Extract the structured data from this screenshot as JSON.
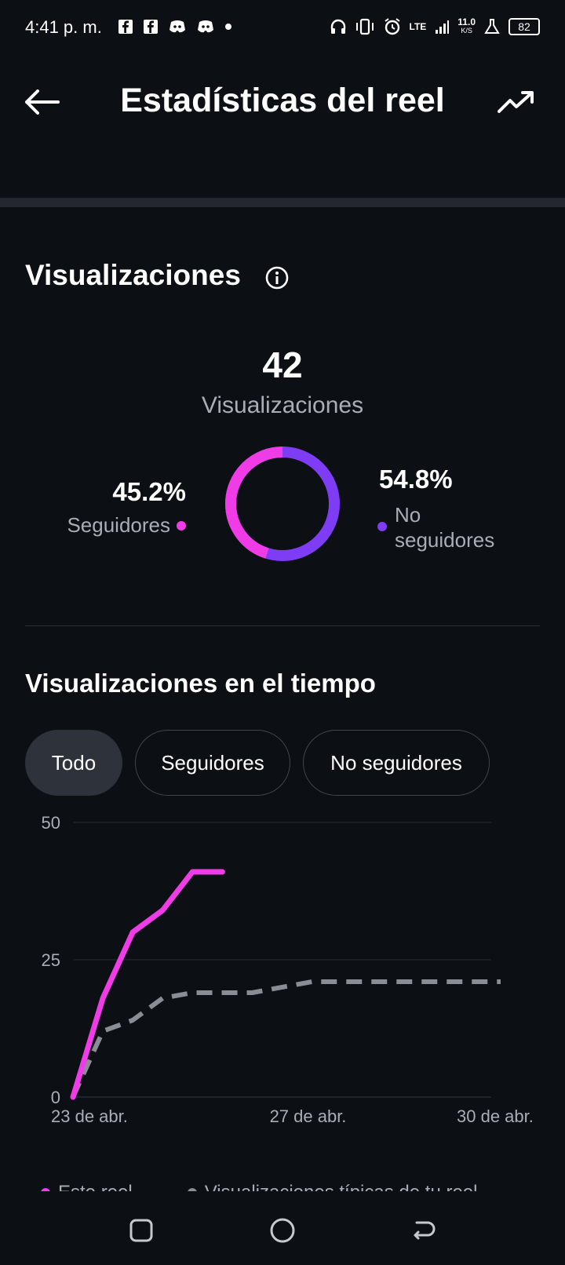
{
  "status": {
    "time": "4:41 p. m.",
    "network": "LTE",
    "speed": "11.0",
    "speed_unit": "K/S",
    "battery": "82",
    "icons": [
      "facebook-icon",
      "facebook-icon",
      "discord-icon",
      "discord-icon",
      "dot-icon",
      "headphones-icon",
      "vibrate-icon",
      "alarm-icon",
      "signal-icon",
      "flask-icon",
      "battery-icon"
    ]
  },
  "header": {
    "title": "Estadísticas del reel",
    "back_icon": "arrow-left-icon",
    "trend_icon": "trending-up-icon"
  },
  "views": {
    "title": "Visualizaciones",
    "total": "42",
    "total_label": "Visualizaciones",
    "followers_pct": "45.2%",
    "followers_label": "Seguidores",
    "non_followers_pct": "54.8%",
    "non_followers_label": "No seguidores",
    "colors": {
      "followers": "#f03ce6",
      "non_followers": "#7f3cf5"
    }
  },
  "over_time": {
    "title": "Visualizaciones en el tiempo",
    "chips": [
      "Todo",
      "Seguidores",
      "No seguidores"
    ],
    "active_chip": "Todo"
  },
  "chart_data": {
    "type": "line",
    "y_ticks": [
      "50",
      "25",
      "0"
    ],
    "x_ticks": [
      "23 de abr.",
      "27 de abr.",
      "30 de abr."
    ],
    "ylim": [
      0,
      50
    ],
    "series": [
      {
        "name": "Este reel",
        "color": "#f03ce6",
        "style": "solid",
        "x": [
          "23 de abr.",
          "23 de abr.",
          "24 de abr.",
          "24 de abr.",
          "25 de abr.",
          "25 de abr."
        ],
        "values": [
          0,
          18,
          30,
          34,
          41,
          41
        ]
      },
      {
        "name": "Visualizaciones típicas de tu reel",
        "color": "#8a8d93",
        "style": "dashed",
        "x": [
          "23 de abr.",
          "23 de abr.",
          "24 de abr.",
          "24 de abr.",
          "25 de abr.",
          "26 de abr.",
          "27 de abr.",
          "30 de abr."
        ],
        "values": [
          0,
          12,
          14,
          18,
          19,
          19,
          21,
          21
        ]
      }
    ]
  },
  "legend": {
    "this_reel": "Este reel",
    "typical": "Visualizaciones típicas de tu reel"
  },
  "nav": {
    "recents_icon": "square-icon",
    "home_icon": "circle-icon",
    "back_icon": "back-arrow-icon"
  }
}
